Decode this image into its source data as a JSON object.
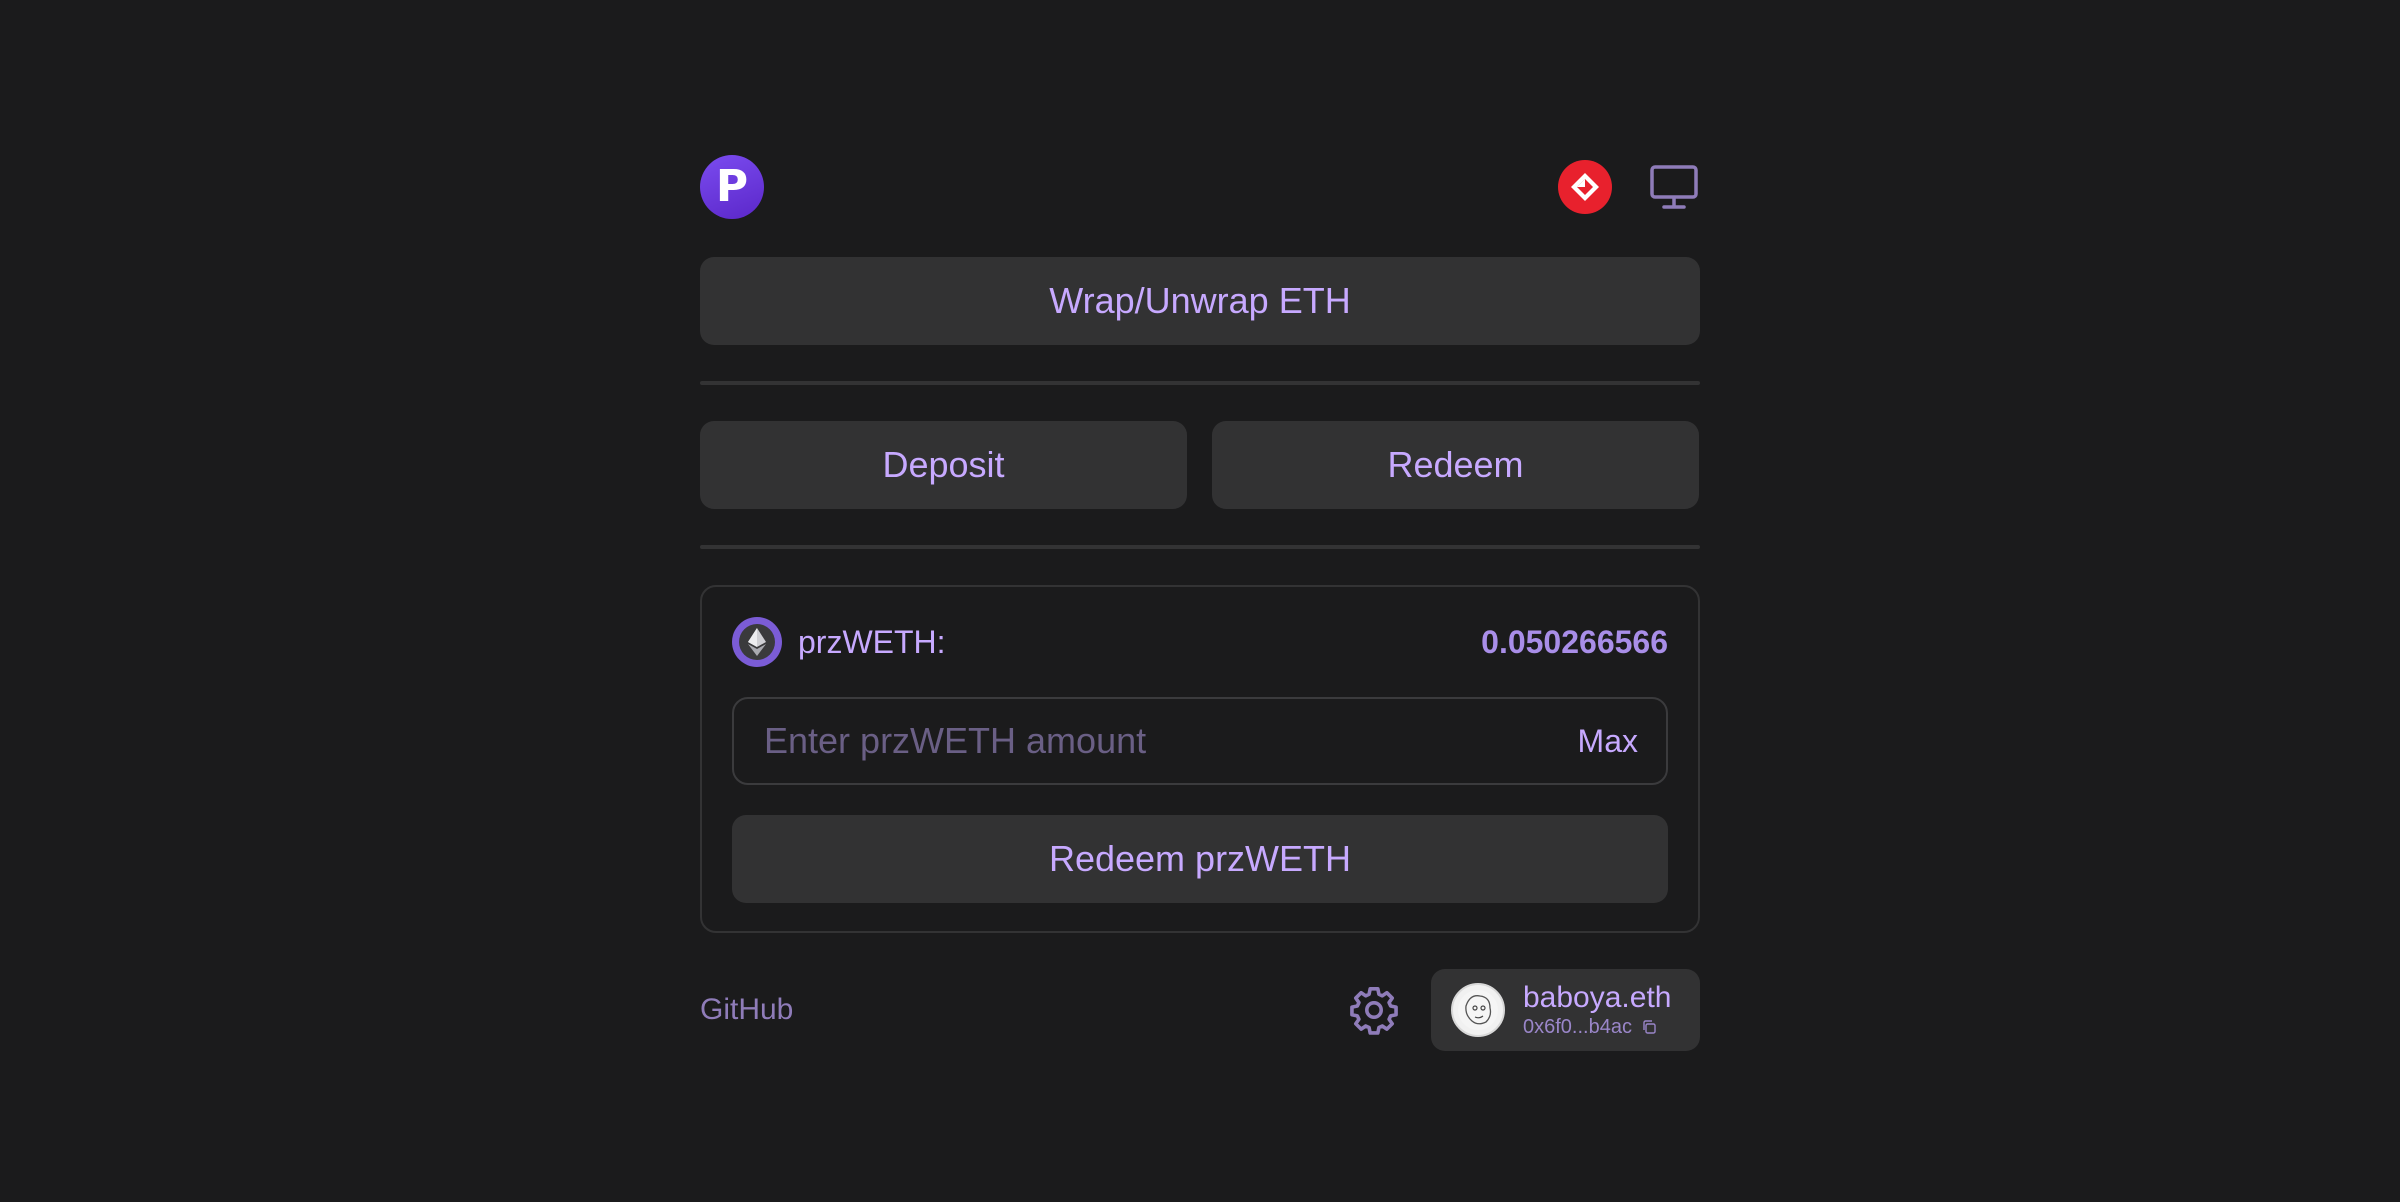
{
  "header": {
    "logo_letter": "P",
    "network_icon": "network-badge-icon",
    "theme_icon": "monitor-icon"
  },
  "buttons": {
    "wrap_label": "Wrap/Unwrap ETH",
    "deposit_label": "Deposit",
    "redeem_label": "Redeem"
  },
  "panel": {
    "token_icon": "eth-icon",
    "token_label": "przWETH:",
    "balance": "0.050266566",
    "input_placeholder": "Enter przWETH amount",
    "input_value": "",
    "max_label": "Max",
    "action_label": "Redeem przWETH"
  },
  "footer": {
    "github_label": "GitHub",
    "settings_icon": "gear-icon",
    "account_name": "baboya.eth",
    "account_address": "0x6f0...b4ac"
  },
  "colors": {
    "background": "#1b1b1c",
    "button_bg": "#323233",
    "accent_text": "#c7a9ff",
    "brand_purple": "#6a35e0",
    "network_red": "#e8212d"
  }
}
